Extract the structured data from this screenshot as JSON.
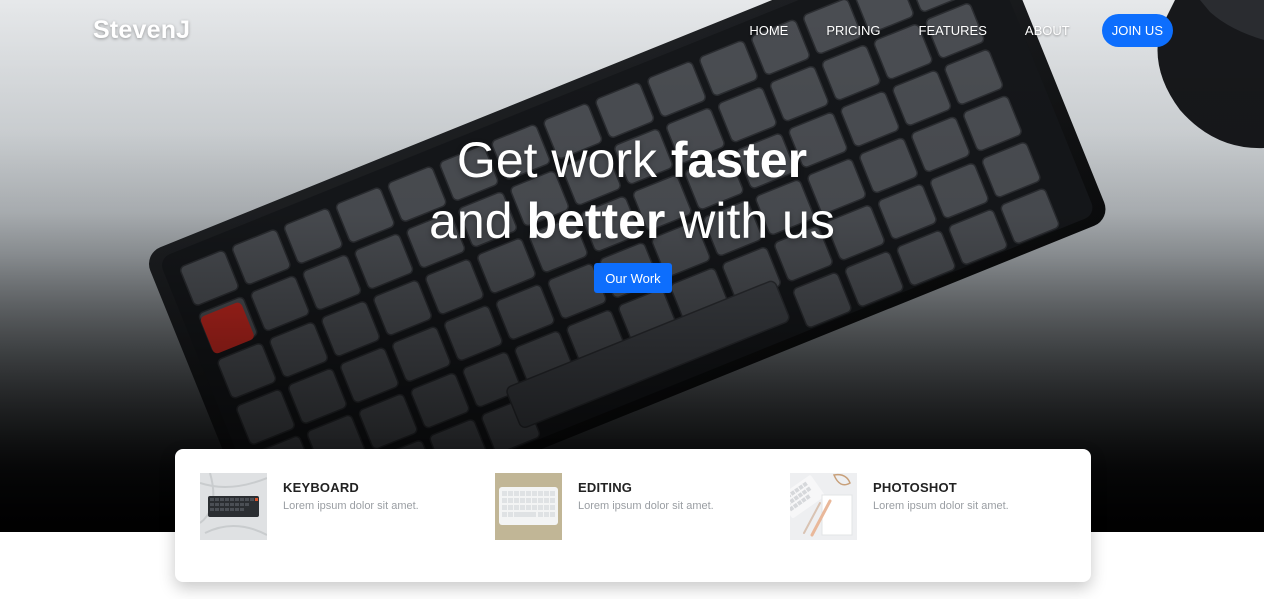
{
  "brand": "StevenJ",
  "nav": {
    "items": [
      {
        "label": "HOME"
      },
      {
        "label": "PRICING"
      },
      {
        "label": "FEATURES"
      },
      {
        "label": "ABOUT"
      }
    ],
    "join_label": "JOIN US"
  },
  "hero": {
    "line1_pre": "Get work ",
    "line1_bold": "faster",
    "line2_pre": "and ",
    "line2_bold": "better",
    "line2_post": " with us",
    "cta_label": "Our Work"
  },
  "features": [
    {
      "title": "KEYBOARD",
      "desc": "Lorem ipsum dolor sit amet."
    },
    {
      "title": "EDITING",
      "desc": "Lorem ipsum dolor sit amet."
    },
    {
      "title": "PHOTOSHOT",
      "desc": "Lorem ipsum dolor sit amet."
    }
  ],
  "colors": {
    "accent": "#0d6efd",
    "heading": "#222222",
    "muted": "#9a9ea3"
  }
}
